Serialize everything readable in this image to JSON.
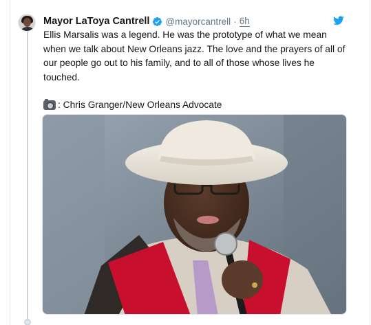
{
  "tweet": {
    "author_name": "Mayor LaToya Cantrell",
    "handle": "@mayorcantrell",
    "separator": "·",
    "time": "6h",
    "text_main": "Ellis Marsalis was a legend. He was the prototype of what we mean when we talk about New Orleans jazz. The love and the prayers of all of our people go out to his family, and to all of those whose lives he touched.",
    "photo_credit": ": Chris Granger/New Orleans Advocate"
  },
  "icons": {
    "verified": "verified-badge-icon",
    "platform": "twitter-bird-icon",
    "camera": "camera-icon"
  },
  "colors": {
    "text": "#14171a",
    "secondary_text": "#657786",
    "verified_blue": "#1da1f2",
    "twitter_blue": "#1da1f2",
    "border": "#e1e8ed"
  }
}
